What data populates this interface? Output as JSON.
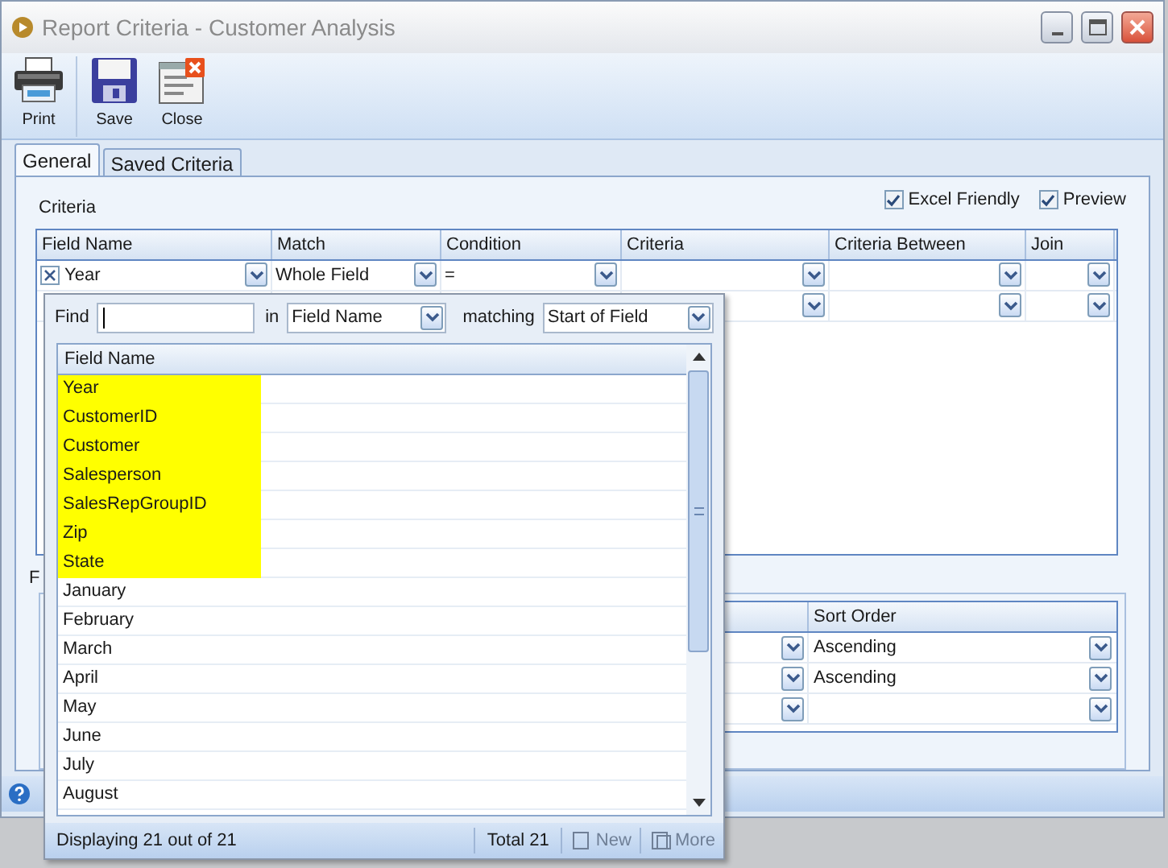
{
  "window": {
    "title": "Report Criteria - Customer Analysis"
  },
  "toolbar": [
    {
      "label": "Print",
      "kind": "print"
    },
    {
      "label": "Save",
      "kind": "save"
    },
    {
      "label": "Close",
      "kind": "close"
    }
  ],
  "tabs": [
    {
      "label": "General",
      "selected": true
    },
    {
      "label": "Saved Criteria",
      "selected": false
    }
  ],
  "criteria": {
    "label": "Criteria",
    "options": [
      {
        "label": "Excel Friendly",
        "checked": true
      },
      {
        "label": "Preview",
        "checked": true
      }
    ],
    "columns": [
      "Field Name",
      "Match",
      "Condition",
      "Criteria",
      "Criteria Between",
      "Join"
    ],
    "rows": [
      {
        "kind": "entry",
        "field_name": "Year",
        "match": "Whole Field",
        "condition": "="
      },
      {
        "kind": "blank"
      }
    ]
  },
  "sort": {
    "label": "F",
    "columns": [
      "Sort Order"
    ],
    "rows": [
      {
        "kind": "entry",
        "sort_order": "Ascending"
      },
      {
        "kind": "entry",
        "sort_order": "Ascending"
      },
      {
        "kind": "blank"
      }
    ]
  },
  "popup": {
    "find_label": "Find",
    "in_label": "in",
    "in_value": "Field Name",
    "matching_label": "matching",
    "matching_value": "Start of Field",
    "column": "Field Name",
    "items": [
      {
        "label": "Year",
        "highlighted": true
      },
      {
        "label": "CustomerID",
        "highlighted": true
      },
      {
        "label": "Customer",
        "highlighted": true
      },
      {
        "label": "Salesperson",
        "highlighted": true
      },
      {
        "label": "SalesRepGroupID",
        "highlighted": true
      },
      {
        "label": "Zip",
        "highlighted": true
      },
      {
        "label": "State",
        "highlighted": true
      },
      {
        "label": "January",
        "highlighted": false
      },
      {
        "label": "February",
        "highlighted": false
      },
      {
        "label": "March",
        "highlighted": false
      },
      {
        "label": "April",
        "highlighted": false
      },
      {
        "label": "May",
        "highlighted": false
      },
      {
        "label": "June",
        "highlighted": false
      },
      {
        "label": "July",
        "highlighted": false
      },
      {
        "label": "August",
        "highlighted": false
      }
    ],
    "status": "Displaying 21 out of 21",
    "total": "Total 21",
    "buttons": [
      {
        "label": "New",
        "disabled": true
      },
      {
        "label": "More",
        "disabled": true
      }
    ]
  }
}
